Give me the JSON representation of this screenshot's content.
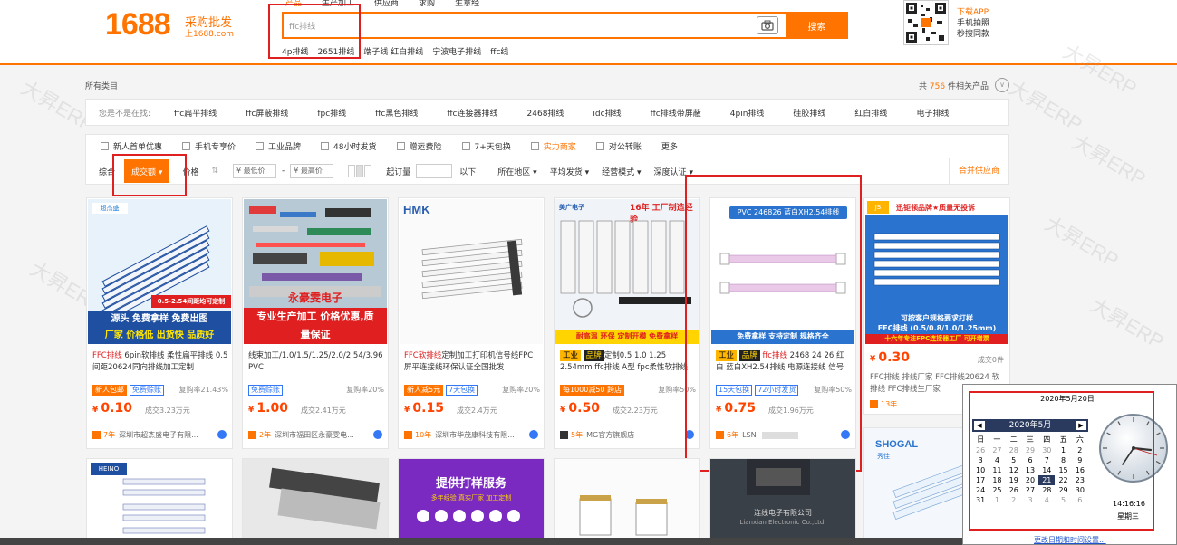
{
  "header": {
    "logo_number": "1688",
    "logo_cn": "采购批发",
    "logo_sub": "上1688.com",
    "top_tabs": [
      "产品",
      "生产加工",
      "供应商",
      "求购",
      "生意经"
    ],
    "search_value": "ffc排线",
    "search_button": "搜索",
    "hot_words": [
      "4p排线",
      "2651排线",
      "端子线 红白排线",
      "宁波电子排线",
      "ffc线"
    ],
    "app_line1": "下载APP",
    "app_line2": "手机拍照",
    "app_line3": "秒搜同款"
  },
  "watermark": "大昇ERP",
  "filters": {
    "all_categories": "所有类目",
    "count_prefix": "共",
    "count_value": "756",
    "count_suffix": "件相关产品",
    "expand_icon": "∨",
    "cat_label": "您是不是在找:",
    "cats": [
      "ffc扁平排线",
      "ffc屏蔽排线",
      "fpc排线",
      "ffc黑色排线",
      "ffc连接器排线",
      "2468排线",
      "idc排线",
      "ffc排线带屏蔽",
      "4pin排线",
      "硅胶排线",
      "红白排线",
      "电子排线"
    ],
    "options": [
      "新人首单优惠",
      "手机专享价",
      "工业品牌",
      "48小时发货",
      "赠运费险",
      "7+天包换",
      "实力商家",
      "对公转账",
      "更多"
    ],
    "sort_items": {
      "overall": "综合",
      "sales": "成交额",
      "price": "价格",
      "min_price": "¥ 最低价",
      "dash": "-",
      "max_price": "¥ 最高价",
      "min_order": "起订量",
      "below": "以下",
      "location": "所在地区",
      "ship_avg": "平均发货",
      "biz_mode": "经营模式",
      "deep_check": "深度认证",
      "merge": "合并供应商"
    }
  },
  "products": [
    {
      "banner_top": "源头 免费拿样 免费出图",
      "banner_bottom": "厂家 价格低 出货快 品质好",
      "banner_side": "0.5-2.54间距均可定制",
      "title_em": "FFC排线",
      "title_rest": " 6pin软排线 柔性扁平排线 0.5间距20624同向排线加工定制",
      "tags": [
        "新人包邮",
        "免费赊账"
      ],
      "rate": "复购率21.43%",
      "price": "0.10",
      "sold": "成交3.23万元",
      "years": "7年",
      "shop": "深圳市超杰盛电子有限..."
    },
    {
      "banner_top": "永豪雯电子",
      "banner_bottom": "专业生产加工 价格优惠,质量保证",
      "title_rest": "线束加工/1.0/1.5/1.25/2.0/2.54/3.96 PVC",
      "tags": [
        "免费赊账"
      ],
      "rate": "复购率20%",
      "price": "1.00",
      "sold": "成交2.41万元",
      "years": "2年",
      "shop": "深圳市福田区永豪雯电..."
    },
    {
      "brand": "HMK",
      "title_em": "FFC软排线",
      "title_rest": "定制加工打印机信号线FPC屏平连接线环保认证全国批发",
      "tags": [
        "新人减5元",
        "7天包换"
      ],
      "rate": "复购率20%",
      "price": "0.15",
      "sold": "成交2.4万元",
      "years": "10年",
      "shop": "深圳市华茂康科技有限..."
    },
    {
      "brand": "美广电子",
      "brand_tag": "16年 工厂制造经验",
      "banner_bottom": "耐高温 环保 定制开模 免费拿样",
      "title_tag1": "工业",
      "title_tag2": "品牌",
      "title_rest": "定制0.5 1.0 1.25 2.54mm ffc排线 A型 fpc柔性软排线",
      "tags": [
        "每1000减50 跨店"
      ],
      "rate": "复购率50%",
      "price": "0.50",
      "sold": "成交2.23万元",
      "years": "5年",
      "shop": "MG官方旗舰店"
    },
    {
      "brand": "PVC 246826 蓝白XH2.54排线",
      "banner_bottom": "免费拿样 支持定制 规格齐全",
      "title_tag1": "工业",
      "title_tag2": "品牌",
      "title_em": "ffc排线",
      "title_rest": " 2468 24 26 红白 蓝白XH2.54排线 电源连接线 信号",
      "tags": [
        "15天包换",
        "72小时发货"
      ],
      "rate": "复购率50%",
      "price": "0.75",
      "sold": "成交1.96万元",
      "years": "6年",
      "shop": "LSN"
    },
    {
      "brand": "迅钜领品牌★质量无投诉",
      "banner_mid": "可按客户规格要求打样",
      "banner_mid2": "FFC排线 (0.5/0.8/1.0/1.25mm)",
      "banner_bottom": "十六年专注FPC连接器工厂  可开增票",
      "title_rest": "FFC排线 排线厂家 FFC排线20624 软排线 FFC排线生厂家",
      "price": "0.30",
      "sold": "成交0件",
      "years": "13年"
    }
  ],
  "bottom_row": {
    "card3_text1": "提供打样服务",
    "card3_text2": "多年经验 真实厂家 加工定制",
    "card5_text": "连线电子有限公司",
    "card5_sub": "Lianxian Electronic Co.,Ltd.",
    "card6_brand": "SHOGAL",
    "card6_brand_cn": "秀佳",
    "card1_brand": "HEINO"
  },
  "calendar": {
    "date_title": "2020年5月20日",
    "month": "2020年5月",
    "prev": "◀",
    "next": "▶",
    "weekdays": [
      "日",
      "一",
      "二",
      "三",
      "四",
      "五",
      "六"
    ],
    "days": [
      "26",
      "27",
      "28",
      "29",
      "30",
      "1",
      "2",
      "3",
      "4",
      "5",
      "6",
      "7",
      "8",
      "9",
      "10",
      "11",
      "12",
      "13",
      "14",
      "15",
      "16",
      "17",
      "18",
      "19",
      "20",
      "21",
      "22",
      "23",
      "24",
      "25",
      "26",
      "27",
      "28",
      "29",
      "30",
      "31",
      "1",
      "2",
      "3",
      "4",
      "5",
      "6"
    ],
    "time": "14:16:16",
    "weekday": "星期三",
    "link": "更改日期和时间设置..."
  },
  "colors": {
    "accent": "#ff7300",
    "highlight": "#e02020",
    "link": "#3478f6"
  }
}
